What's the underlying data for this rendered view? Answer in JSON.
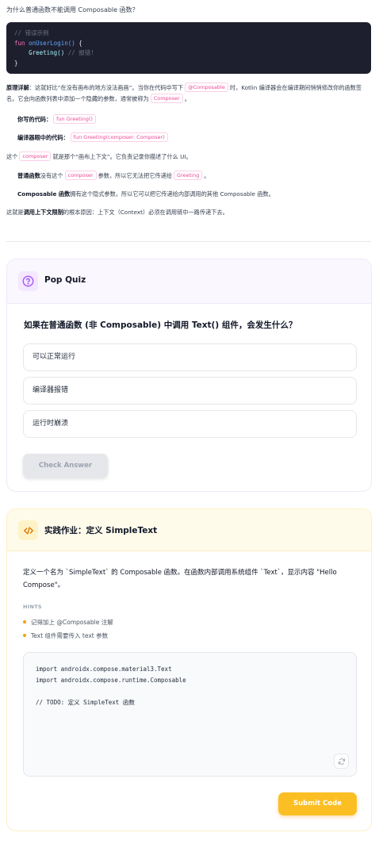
{
  "lesson": {
    "question": "为什么普通函数不能调用 Composable 函数？",
    "code_example": {
      "comment": "// 错误示例",
      "kw_fun": "fun",
      "fn_name": "onUserLogin()",
      "brace_open": " {",
      "call": "Greeting()",
      "inline_comment": " // 报错!",
      "brace_close": "}"
    },
    "explanation": {
      "p1_label": "原理详解",
      "p1_a": "：这就好比“在没有画布的地方没法画画”。当你在代码中写下",
      "p1_tag": "@Composable",
      "p1_b": "时，Kotlin 编译器会在编译期间悄悄修改你的函数签名。它会向函数列表中添加一个隐藏的参数，通常被称为",
      "p1_tag2": "Composer",
      "p1_c": "。",
      "p2_label": "你写的代码：",
      "p2_tag": "fun Greeting()",
      "p3_label": "编译器眼中的代码：",
      "p3_tag": "fun Greeting(composer: Composer)",
      "p4_a": "这个",
      "p4_tag": "composer",
      "p4_b": "就是那个“画布上下文”。它负责记录你描述了什么 UI。",
      "p5_label": "普通函数",
      "p5_a": "没有这个",
      "p5_tag": "composer",
      "p5_b": "参数，所以它无法把它传递给",
      "p5_tag2": "Greeting",
      "p5_c": "。",
      "p6_label": "Composable 函数",
      "p6_a": "拥有这个隐式参数，所以它可以把它传递给内部调用的其他 Composable 函数。",
      "p7_a": "这就是",
      "p7_label": "调用上下文限制",
      "p7_b": "的根本原因：上下文（Context）必须在调用链中一路传递下去。"
    }
  },
  "quiz": {
    "title": "Pop Quiz",
    "icon": "question-circle-icon",
    "question": "如果在普通函数 (非 Composable) 中调用 Text() 组件，会发生什么？",
    "options": [
      "可以正常运行",
      "编译器报错",
      "运行时崩溃"
    ],
    "check_label": "Check Answer",
    "accent": "#a855f7"
  },
  "homework": {
    "title": "实践作业：定义 SimpleText",
    "icon": "code-icon",
    "description": "定义一个名为 `SimpleText` 的 Composable 函数。在函数内部调用系统组件 `Text`，显示内容 \"Hello Compose\"。",
    "hints_label": "HINTS",
    "hints": [
      "记得加上 @Composable 注解",
      "Text 组件需要传入 text 参数"
    ],
    "code": "import androidx.compose.material3.Text\nimport androidx.compose.runtime.Composable\n\n// TODO: 定义 SimpleText 函数",
    "reset_icon": "refresh-icon",
    "submit_label": "Submit Code",
    "accent": "#fbbf24"
  }
}
